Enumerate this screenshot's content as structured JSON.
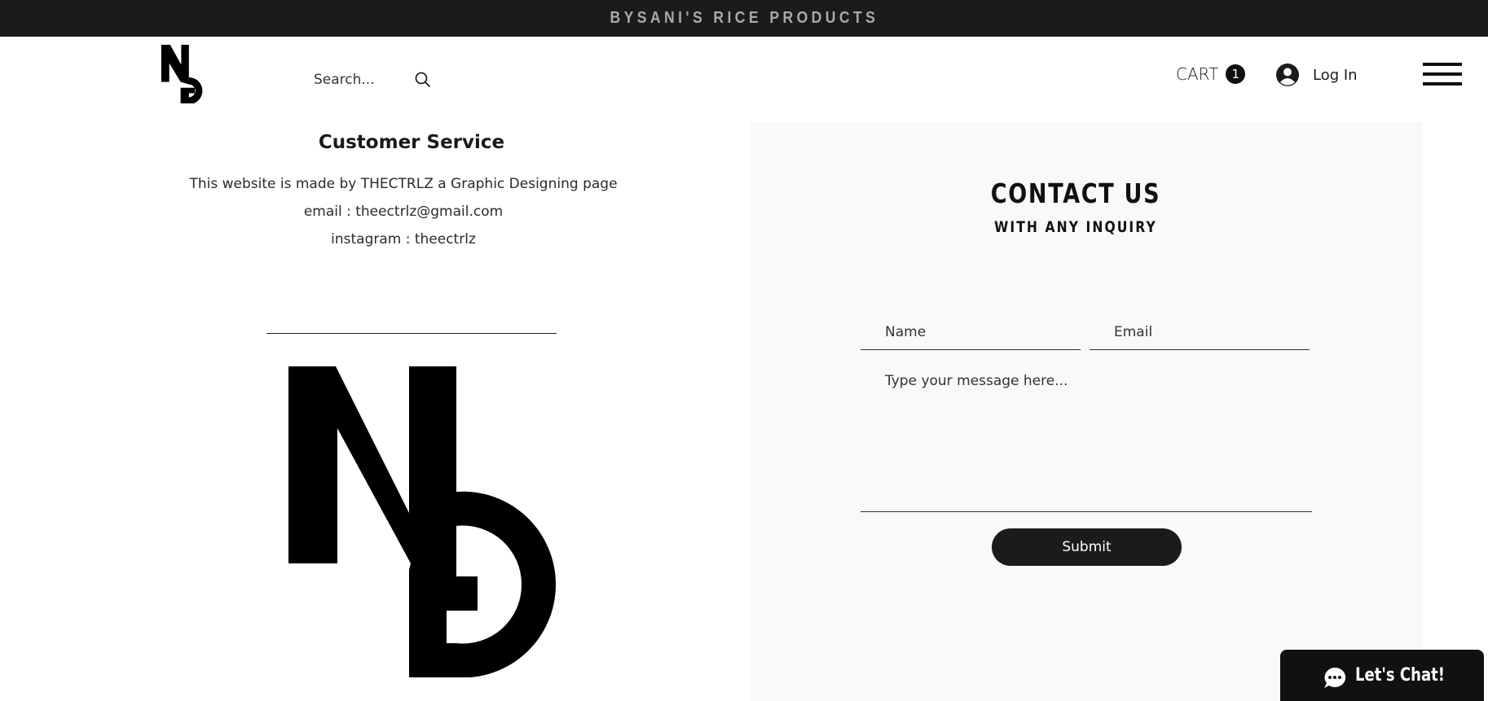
{
  "announcement": {
    "text": "BYSANI'S RICE PRODUCTS"
  },
  "header": {
    "search_placeholder": "Search...",
    "cart_label": "CART",
    "cart_count": "1",
    "login_label": "Log In"
  },
  "customer_service": {
    "title": "Customer Service",
    "lines": [
      "This website is made by THECTRLZ a Graphic Designing page",
      "email : theectrlz@gmail.com",
      "instagram : theectrlz"
    ]
  },
  "contact": {
    "title": "CONTACT US",
    "subtitle": "WITH ANY INQUIRY",
    "name_placeholder": "Name",
    "email_placeholder": "Email",
    "message_placeholder": "Type your message here...",
    "submit_label": "Submit"
  },
  "chat": {
    "label": "Let's Chat!"
  },
  "icons": {
    "logo": "ng-logo-icon",
    "search": "search-icon",
    "avatar": "user-avatar-icon",
    "menu": "hamburger-menu-icon",
    "chat": "chat-bubble-icon"
  },
  "colors": {
    "bar": "#1b1b1b",
    "panel": "#f9f9f9",
    "accent": "#111111",
    "announce_text": "#a9a9a9"
  }
}
